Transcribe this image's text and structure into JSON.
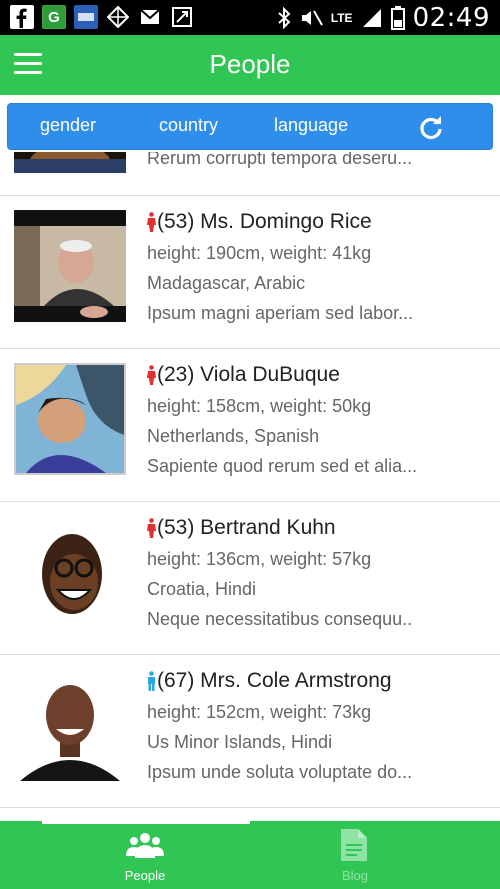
{
  "status_bar": {
    "time": "02:49",
    "network": "LTE",
    "icons": [
      "facebook-icon",
      "g-market-icon",
      "app-icon",
      "network-icon",
      "gmail-icon",
      "tool-icon",
      "bluetooth-icon",
      "mute-icon",
      "signal-icon",
      "battery-icon"
    ]
  },
  "header": {
    "title": "People",
    "menu_icon": "hamburger-menu-icon"
  },
  "filters": {
    "gender": "gender",
    "country": "country",
    "language": "language",
    "refresh_icon": "refresh-icon"
  },
  "people": [
    {
      "partial": true,
      "name": "",
      "measurements": "",
      "location": "",
      "bio": "Rerum corrupti tempora deseru..."
    },
    {
      "gender": "female",
      "name": "(53) Ms. Domingo Rice",
      "measurements": "height: 190cm, weight: 41kg",
      "location": "Madagascar, Arabic",
      "bio": "Ipsum magni aperiam sed labor..."
    },
    {
      "gender": "female",
      "name": "(23) Viola DuBuque",
      "measurements": "height: 158cm, weight: 50kg",
      "location": "Netherlands, Spanish",
      "bio": "Sapiente quod rerum sed et alia..."
    },
    {
      "gender": "female",
      "name": "(53) Bertrand Kuhn",
      "measurements": "height: 136cm, weight: 57kg",
      "location": "Croatia, Hindi",
      "bio": "Neque necessitatibus consequu.."
    },
    {
      "gender": "male",
      "name": "(67) Mrs. Cole Armstrong",
      "measurements": "height: 152cm, weight: 73kg",
      "location": "Us Minor Islands, Hindi",
      "bio": "Ipsum unde soluta voluptate do..."
    }
  ],
  "bottom_nav": {
    "tabs": [
      {
        "label": "People",
        "icon": "people-icon",
        "active": true
      },
      {
        "label": "Blog",
        "icon": "document-icon",
        "active": false
      }
    ]
  },
  "colors": {
    "primary_green": "#31c553",
    "filter_blue": "#2f8eec",
    "female_icon": "#e0312f",
    "male_icon": "#2ba7e0",
    "inactive_tab": "#8ee3a4"
  }
}
